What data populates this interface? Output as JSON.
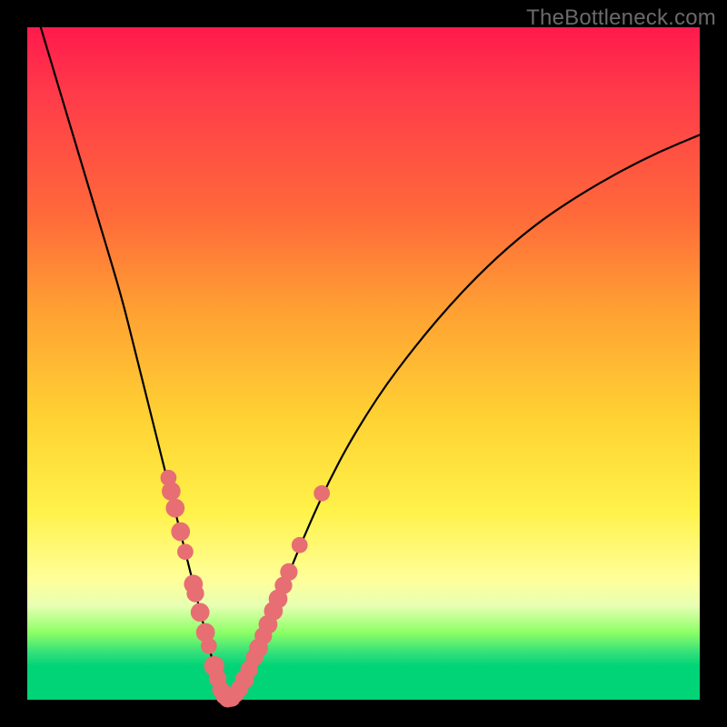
{
  "watermark": "TheBottleneck.com",
  "chart_data": {
    "type": "line",
    "title": "",
    "xlabel": "",
    "ylabel": "",
    "xlim": [
      0,
      100
    ],
    "ylim": [
      0,
      100
    ],
    "grid": false,
    "legend": false,
    "series": [
      {
        "name": "bottleneck-curve",
        "x": [
          2,
          5,
          8,
          11,
          14,
          16,
          18,
          20,
          21.5,
          23,
          24.5,
          26,
          27,
          28,
          29,
          29.5,
          30,
          32,
          34,
          37,
          41,
          46,
          52,
          58,
          64,
          70,
          76,
          82,
          88,
          94,
          100
        ],
        "y": [
          100,
          90,
          80,
          70,
          60,
          52,
          44,
          36,
          30,
          24,
          18,
          12,
          8,
          4,
          2,
          0.5,
          0,
          2,
          6,
          14,
          24,
          35,
          45,
          53,
          60,
          66,
          71,
          75,
          78.5,
          81.5,
          84
        ]
      }
    ],
    "markers": [
      {
        "name": "curve-marker-left",
        "x": 21.0,
        "y": 33.0,
        "r": 1.2
      },
      {
        "name": "curve-marker-left",
        "x": 21.4,
        "y": 31.0,
        "r": 1.4
      },
      {
        "name": "curve-marker-left",
        "x": 22.0,
        "y": 28.5,
        "r": 1.4
      },
      {
        "name": "curve-marker-left",
        "x": 22.8,
        "y": 25.0,
        "r": 1.4
      },
      {
        "name": "curve-marker-left",
        "x": 23.5,
        "y": 22.0,
        "r": 1.2
      },
      {
        "name": "curve-marker-left",
        "x": 24.7,
        "y": 17.2,
        "r": 1.4
      },
      {
        "name": "curve-marker-left",
        "x": 25.0,
        "y": 15.8,
        "r": 1.3
      },
      {
        "name": "curve-marker-left",
        "x": 25.7,
        "y": 13.0,
        "r": 1.4
      },
      {
        "name": "curve-marker-left",
        "x": 26.5,
        "y": 10.0,
        "r": 1.4
      },
      {
        "name": "curve-marker-left",
        "x": 27.0,
        "y": 8.0,
        "r": 1.2
      },
      {
        "name": "curve-marker-left",
        "x": 27.8,
        "y": 5.0,
        "r": 1.5
      },
      {
        "name": "curve-marker-left",
        "x": 28.3,
        "y": 3.2,
        "r": 1.3
      },
      {
        "name": "curve-marker-bottom",
        "x": 28.8,
        "y": 1.5,
        "r": 1.3
      },
      {
        "name": "curve-marker-bottom",
        "x": 29.3,
        "y": 0.6,
        "r": 1.3
      },
      {
        "name": "curve-marker-bottom",
        "x": 29.8,
        "y": 0.15,
        "r": 1.3
      },
      {
        "name": "curve-marker-bottom",
        "x": 30.4,
        "y": 0.25,
        "r": 1.3
      },
      {
        "name": "curve-marker-bottom",
        "x": 31.0,
        "y": 0.9,
        "r": 1.3
      },
      {
        "name": "curve-marker-bottom",
        "x": 31.6,
        "y": 1.7,
        "r": 1.3
      },
      {
        "name": "curve-marker-right",
        "x": 32.3,
        "y": 3.0,
        "r": 1.4
      },
      {
        "name": "curve-marker-right",
        "x": 33.0,
        "y": 4.5,
        "r": 1.3
      },
      {
        "name": "curve-marker-right",
        "x": 33.8,
        "y": 6.3,
        "r": 1.3
      },
      {
        "name": "curve-marker-right",
        "x": 34.4,
        "y": 7.7,
        "r": 1.4
      },
      {
        "name": "curve-marker-right",
        "x": 35.1,
        "y": 9.5,
        "r": 1.3
      },
      {
        "name": "curve-marker-right",
        "x": 35.8,
        "y": 11.2,
        "r": 1.4
      },
      {
        "name": "curve-marker-right",
        "x": 36.6,
        "y": 13.2,
        "r": 1.4
      },
      {
        "name": "curve-marker-right",
        "x": 37.3,
        "y": 15.0,
        "r": 1.4
      },
      {
        "name": "curve-marker-right",
        "x": 38.1,
        "y": 17.0,
        "r": 1.3
      },
      {
        "name": "curve-marker-right",
        "x": 38.9,
        "y": 19.0,
        "r": 1.3
      },
      {
        "name": "curve-marker-right",
        "x": 40.5,
        "y": 23.0,
        "r": 1.2
      },
      {
        "name": "curve-marker-right",
        "x": 43.8,
        "y": 30.7,
        "r": 1.2
      }
    ],
    "marker_color": "#e76e72"
  }
}
